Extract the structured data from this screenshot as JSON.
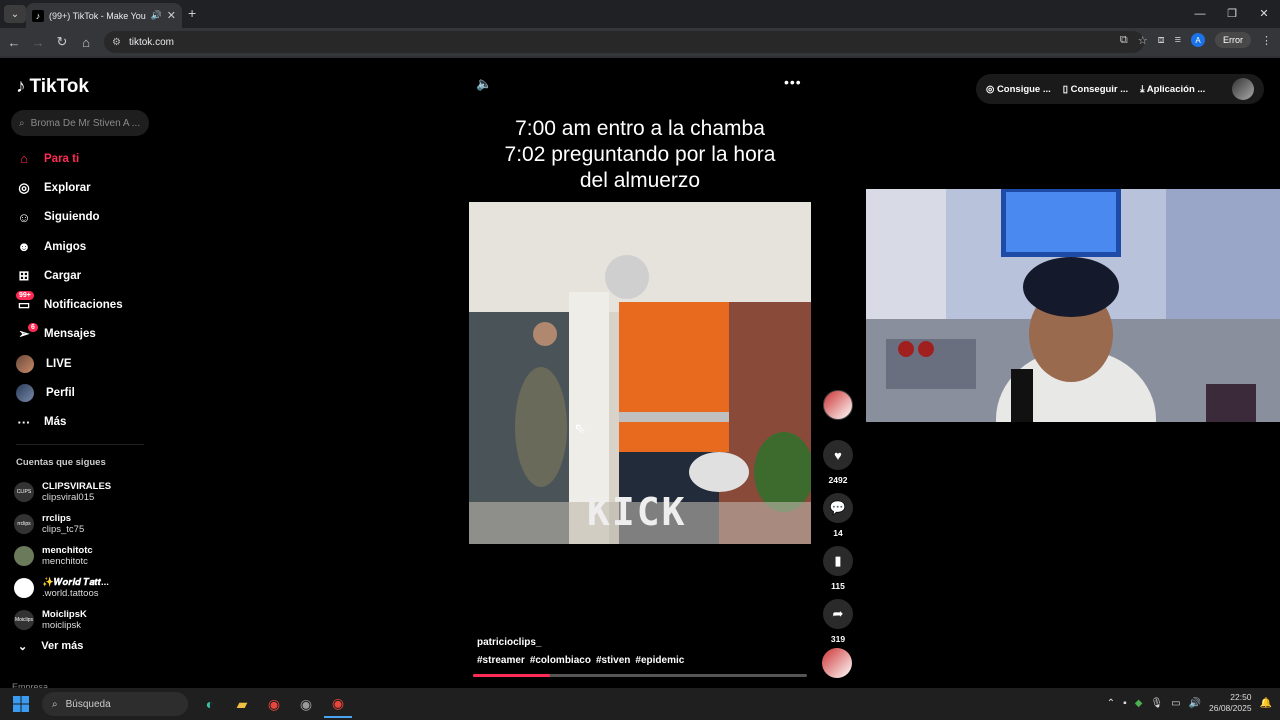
{
  "browser": {
    "tab_title": "(99+) TikTok - Make Your Day",
    "tab_count_icon": "v",
    "url": "tiktok.com",
    "error_label": "Error",
    "profile_initial": "A"
  },
  "app": {
    "logo": "TikTok",
    "search_placeholder": "Broma De Mr Stiven A ..."
  },
  "sidebar": {
    "items": [
      {
        "label": "Para ti",
        "icon": "home-icon"
      },
      {
        "label": "Explorar",
        "icon": "compass-icon"
      },
      {
        "label": "Siguiendo",
        "icon": "following-icon"
      },
      {
        "label": "Amigos",
        "icon": "friends-icon"
      },
      {
        "label": "Cargar",
        "icon": "upload-icon"
      },
      {
        "label": "Notificaciones",
        "icon": "inbox-icon",
        "badge": "99+"
      },
      {
        "label": "Mensajes",
        "icon": "send-icon",
        "badge": "6"
      },
      {
        "label": "LIVE",
        "icon": "live-icon"
      },
      {
        "label": "Perfil",
        "icon": "profile-icon"
      },
      {
        "label": "Más",
        "icon": "more-icon"
      }
    ],
    "following_title": "Cuentas que sigues",
    "following": [
      {
        "name": "CLIPSVIRALES",
        "handle": "clipsviral015",
        "avatar_text": "CLIPS"
      },
      {
        "name": "rrclips",
        "handle": "clips_tc75",
        "avatar_text": "rrclips"
      },
      {
        "name": "menchitotc",
        "handle": "menchitotc",
        "avatar_text": ""
      },
      {
        "name": "✨𝑾𝒐𝒓𝒍𝒅 𝑻𝒂𝒕𝒕...",
        "handle": ".world.tattoos",
        "avatar_text": ""
      },
      {
        "name": "MoiclipsK",
        "handle": "moiclipsk",
        "avatar_text": "Moiclips"
      }
    ],
    "see_more": "Ver más",
    "footer_partial": "Empresa"
  },
  "video": {
    "caption_lines": [
      "7:00 am entro a la chamba",
      "7:02 preguntando por la hora",
      "del almuerzo"
    ],
    "watermark": "KICK",
    "author": "patricioclips_",
    "tags": [
      "#streamer",
      "#colombiaco",
      "#stiven",
      "#epidemic"
    ],
    "progress": 0.23,
    "likes": "2492",
    "comments": "14",
    "saves": "115",
    "shares": "319"
  },
  "top_buttons": {
    "coins": "Consigue ...",
    "get": "Conseguir ...",
    "app": "Aplicación ..."
  },
  "taskbar": {
    "search_label": "Búsqueda",
    "time": "22:50",
    "date": "26/08/2025"
  },
  "colors": {
    "accent": "#fe2c55",
    "background": "#000000"
  }
}
